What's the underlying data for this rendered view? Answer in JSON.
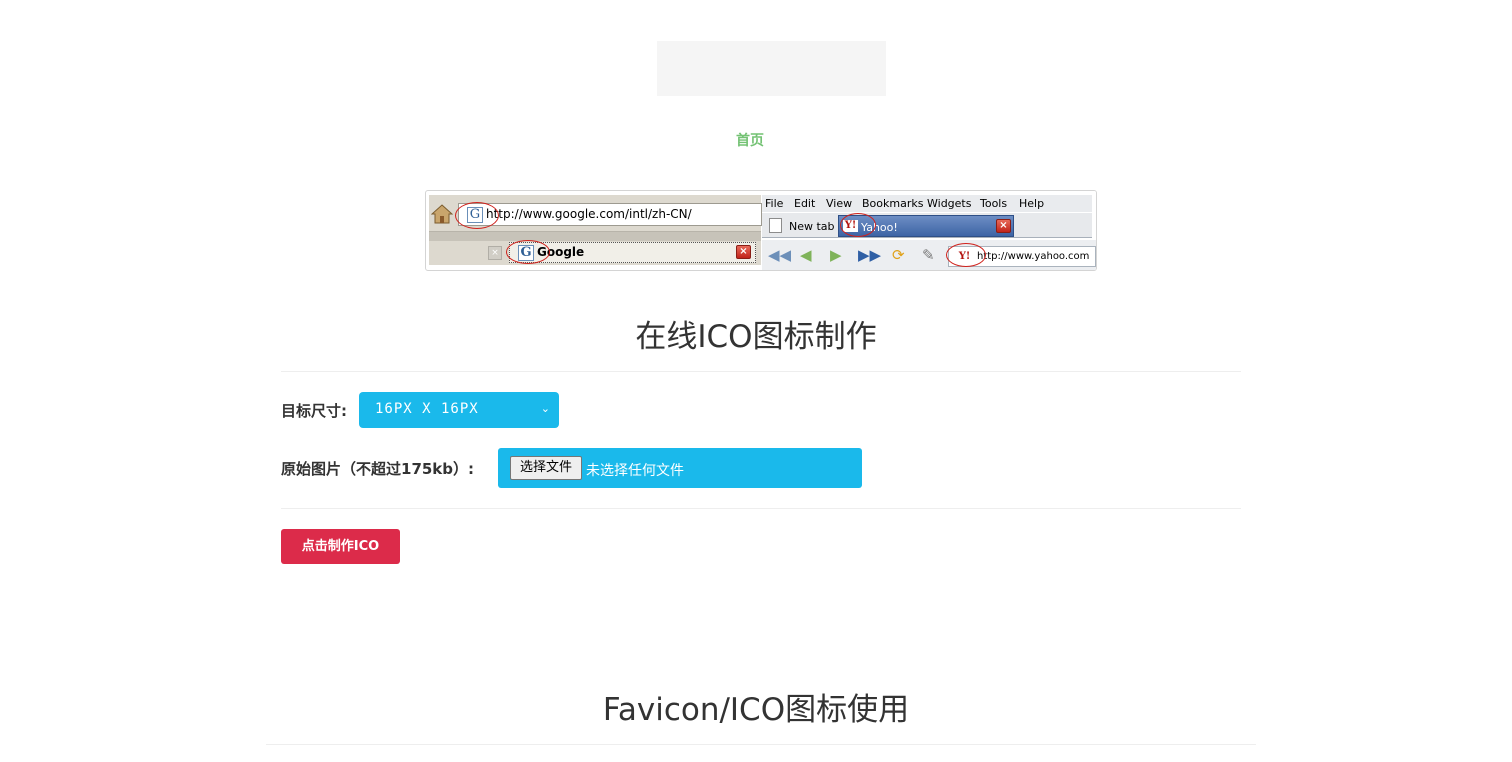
{
  "nav": {
    "home": "首页"
  },
  "demo": {
    "google_url": "http://www.google.com/intl/zh-CN/",
    "google_tab": "Google",
    "g_letter": "G",
    "close_glyph": "×",
    "menu": [
      "File",
      "Edit",
      "View",
      "Bookmarks",
      "Widgets",
      "Tools",
      "Help"
    ],
    "new_tab": "New tab",
    "yahoo_tab": "Yahoo!",
    "y_letter": "Y!",
    "yahoo_url": "http://www.yahoo.com",
    "icons": [
      "home-icon",
      "google-favicon",
      "doc-icon",
      "yahoo-favicon",
      "rewind-icon",
      "back-icon",
      "forward-icon",
      "fast-forward-icon",
      "reload-icon",
      "pen-icon"
    ]
  },
  "section1": {
    "title": "在线ICO图标制作"
  },
  "form": {
    "size_label": "目标尺寸:",
    "size_value": "16PX X 16PX",
    "image_label": "原始图片（不超过175kb）:",
    "file_button": "选择文件",
    "file_status": "未选择任何文件",
    "submit": "点击制作ICO"
  },
  "section2": {
    "title": "Favicon/ICO图标使用"
  },
  "colors": {
    "accent": "#1ab9eb",
    "submit": "#dc2b4a",
    "nav": "#5cb85c"
  }
}
